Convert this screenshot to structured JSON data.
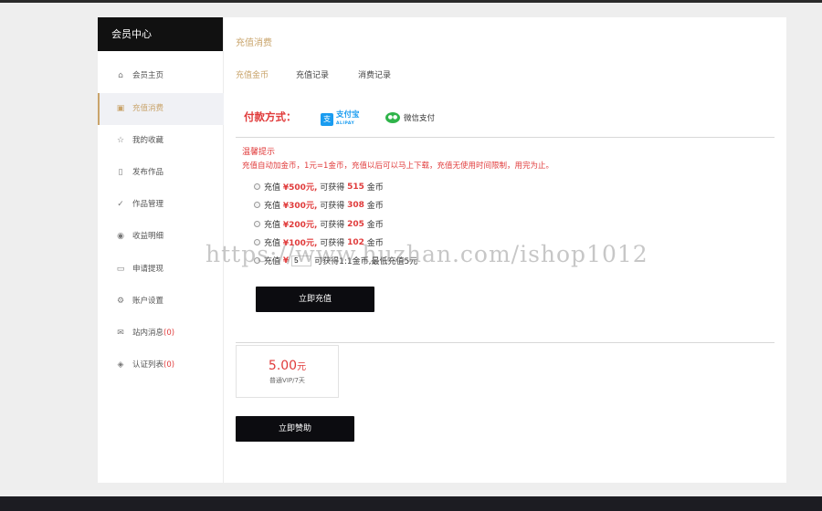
{
  "sidebar": {
    "title": "会员中心",
    "items": [
      {
        "label": "会员主页",
        "icon": "home-icon",
        "glyph": "⌂",
        "count": "",
        "active": false
      },
      {
        "label": "充值消费",
        "icon": "wallet-icon",
        "glyph": "▣",
        "count": "",
        "active": true
      },
      {
        "label": "我的收藏",
        "icon": "star-icon",
        "glyph": "☆",
        "count": "",
        "active": false
      },
      {
        "label": "发布作品",
        "icon": "document-icon",
        "glyph": "▯",
        "count": "",
        "active": false
      },
      {
        "label": "作品管理",
        "icon": "check-circle-icon",
        "glyph": "✓",
        "count": "",
        "active": false
      },
      {
        "label": "收益明细",
        "icon": "coin-icon",
        "glyph": "◉",
        "count": "",
        "active": false
      },
      {
        "label": "申请提现",
        "icon": "withdraw-icon",
        "glyph": "▭",
        "count": "",
        "active": false
      },
      {
        "label": "账户设置",
        "icon": "gear-icon",
        "glyph": "⚙",
        "count": "",
        "active": false
      },
      {
        "label": "站内消息",
        "icon": "mail-icon",
        "glyph": "✉",
        "count": "(0)",
        "active": false
      },
      {
        "label": "认证列表",
        "icon": "shield-icon",
        "glyph": "◈",
        "count": "(0)",
        "active": false
      }
    ]
  },
  "main": {
    "section_title": "充值消费",
    "tabs": [
      {
        "label": "充值金币",
        "active": true
      },
      {
        "label": "充值记录",
        "active": false
      },
      {
        "label": "消费记录",
        "active": false
      }
    ],
    "pay_label": "付款方式：",
    "alipay": {
      "glyph": "支",
      "label": "支付宝",
      "sub": "ALIPAY"
    },
    "wechat": {
      "label": "微信支付"
    },
    "tip_title": "温馨提示",
    "tip_text": "充值自动加金币，1元=1金币，充值以后可以马上下载，充值无使用时间限制，用完为止。",
    "options": [
      {
        "prefix": "充值",
        "amount": "¥500元,",
        "mid": "可获得",
        "coins": "515",
        "suffix": "金币"
      },
      {
        "prefix": "充值",
        "amount": "¥300元,",
        "mid": "可获得",
        "coins": "308",
        "suffix": "金币"
      },
      {
        "prefix": "充值",
        "amount": "¥200元,",
        "mid": "可获得",
        "coins": "205",
        "suffix": "金币"
      },
      {
        "prefix": "充值",
        "amount": "¥100元,",
        "mid": "可获得",
        "coins": "102",
        "suffix": "金币"
      }
    ],
    "custom_option": {
      "prefix": "充值",
      "currency": "¥",
      "value": "5",
      "rest": "可获得1:1金币,最低充值5元"
    },
    "recharge_button": "立即充值",
    "vip": {
      "price": "5.00",
      "unit": "元",
      "desc": "普通VIP/7天"
    },
    "sponsor_button": "立即赞助"
  },
  "watermark": "https://www.huzhan.com/ishop1012",
  "colors": {
    "accent": "#c9a46b",
    "highlight": "#e03b3b",
    "dark": "#0c0c10",
    "alipay": "#1a9cf0",
    "wechat": "#2fb44a"
  }
}
